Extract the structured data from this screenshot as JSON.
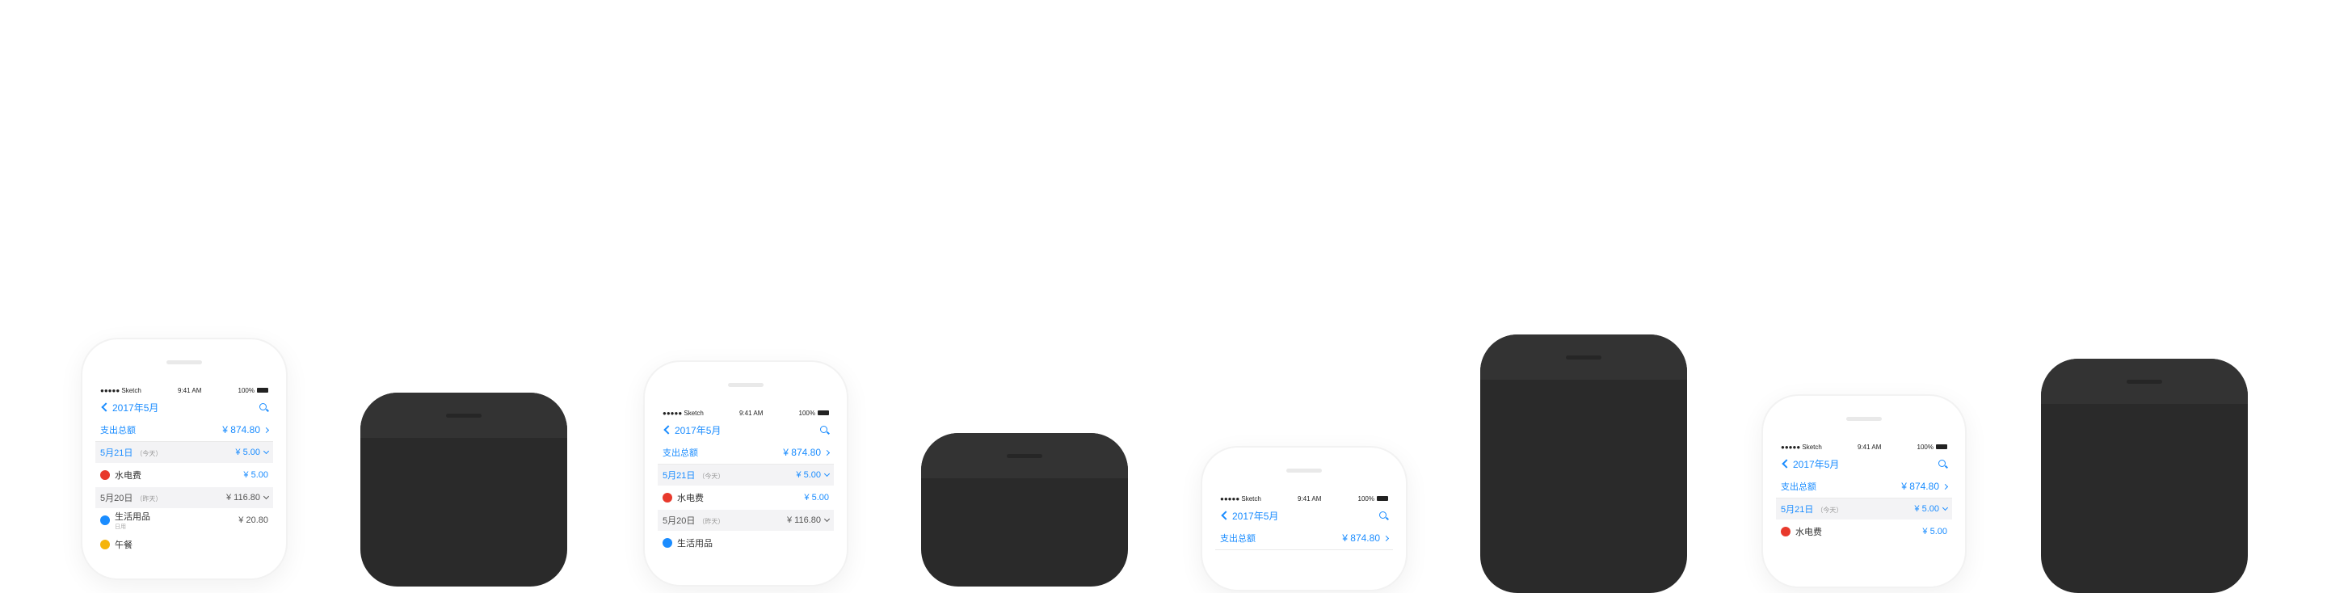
{
  "app": {
    "status": {
      "carrier": "●●●●● Sketch",
      "time": "9:41 AM",
      "battery": "100%"
    },
    "nav": {
      "back_label": "2017年5月"
    },
    "total": {
      "label": "支出总额",
      "amount": "¥ 874.80"
    },
    "days": [
      {
        "date": "5月21日",
        "tag": "（今天）",
        "amount": "¥ 5.00",
        "items": [
          {
            "name": "水电费",
            "amount": "¥ 5.00",
            "color": "#e8392c"
          }
        ]
      },
      {
        "date": "5月20日",
        "tag": "（昨天）",
        "amount": "¥ 116.80",
        "items": [
          {
            "name": "生活用品",
            "note": "日用",
            "amount": "¥ 20.80",
            "color": "#1a8cff"
          },
          {
            "name": "午餐",
            "amount": "",
            "color": "#f5b40a"
          }
        ]
      }
    ]
  },
  "colors": {
    "accent": "#1a8cff",
    "phone_dark": "#2a2a2a",
    "phone_white": "#ffffff"
  },
  "icons": {
    "back": "chevron-left-icon",
    "search": "search-icon",
    "wifi": "wifi-icon",
    "battery": "battery-icon"
  }
}
